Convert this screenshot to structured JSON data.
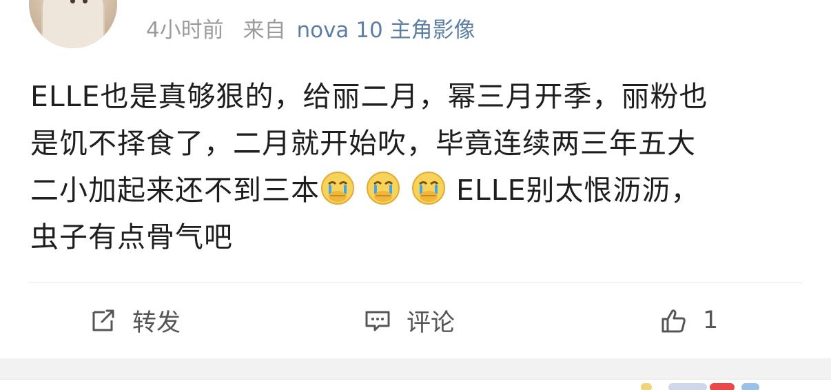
{
  "post": {
    "meta": {
      "time": "4小时前",
      "from_label": "来自",
      "device": "nova 10 主角影像"
    },
    "content_lines": [
      "ELLE也是真够狠的，给丽二月，幂三月开季，丽粉也",
      "是饥不择食了，二月就开始吹，毕竟连续两三年五大",
      "二小加起来还不到三本",
      "ELLE别太恨沥沥，",
      "虫子有点骨气吧"
    ],
    "emoji_names": [
      "crying-covering-mouth-emoji",
      "crying-covering-mouth-emoji",
      "crying-covering-mouth-emoji"
    ]
  },
  "actions": {
    "repost_label": "转发",
    "comment_label": "评论",
    "like_count": "1"
  },
  "icons": {
    "repost": "share-icon",
    "comment": "comment-icon",
    "like": "thumbs-up-icon"
  },
  "colors": {
    "device_link": "#5d7fa3",
    "meta_gray": "#9b9b9b",
    "action_gray": "#555555"
  }
}
